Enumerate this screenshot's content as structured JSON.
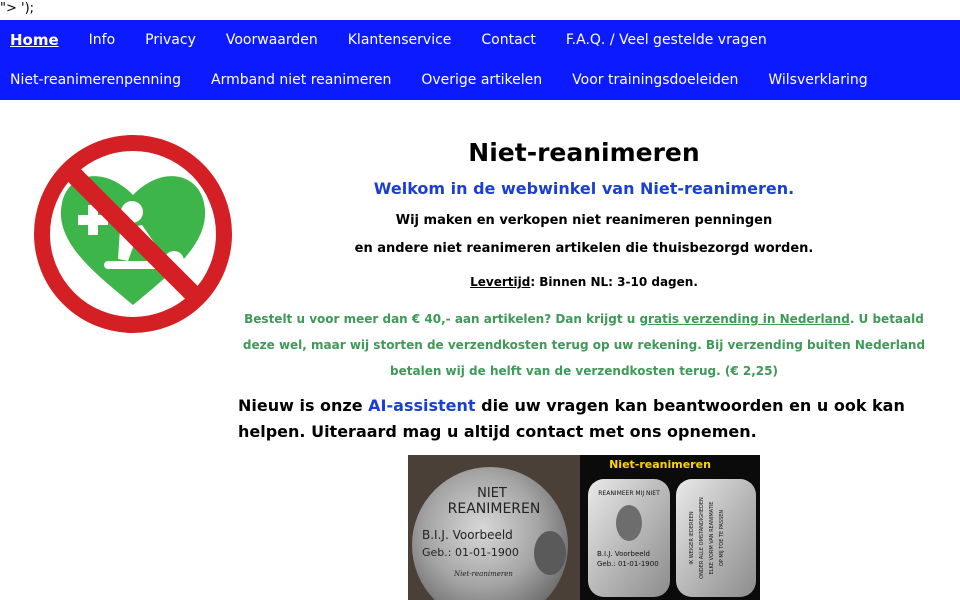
{
  "stray_text": "\"> ');",
  "nav": {
    "row1": [
      {
        "label": "Home",
        "active": true
      },
      {
        "label": "Info"
      },
      {
        "label": "Privacy"
      },
      {
        "label": "Voorwaarden"
      },
      {
        "label": "Klantenservice"
      },
      {
        "label": "Contact"
      },
      {
        "label": "F.A.Q. / Veel gestelde vragen"
      }
    ],
    "row2": [
      {
        "label": "Niet-reanimerenpenning"
      },
      {
        "label": "Armband niet reanimeren"
      },
      {
        "label": "Overige artikelen"
      },
      {
        "label": "Voor trainingsdoeleiden"
      },
      {
        "label": "Wilsverklaring"
      }
    ]
  },
  "main": {
    "title": "Niet-reanimeren",
    "welcome": "Welkom in de webwinkel van Niet-reanimeren.",
    "line1": "Wij maken en verkopen niet reanimeren penningen",
    "line2": "en andere niet reanimeren artikelen die thuisbezorgd worden.",
    "delivery": {
      "label": "Levertijd",
      "text": ": Binnen NL: 3-10 dagen."
    },
    "shipping": {
      "part1": "Bestelt u voor meer dan € 40,- aan artikelen? Dan krijgt u ",
      "link": "gratis verzending in Nederland",
      "part2": ". U betaald",
      "line2": "deze wel, maar wij storten de verzendkosten terug op uw rekening. Bij verzending buiten Nederland",
      "line3": "betalen wij de helft van de verzendkosten terug. (€ 2,25)"
    },
    "ai": {
      "before": "Nieuw is onze ",
      "link": "AI-assistent",
      "after": " die uw vragen kan beantwoorden en u ook kan",
      "line2": "helpen. Uiteraard mag u altijd contact met ons opnemen."
    }
  },
  "product_image": {
    "banner": "Niet-reanimeren",
    "coin_line1": "NIET",
    "coin_line2": "REANIMEREN",
    "coin_name": "B.I.J. Voorbeeld",
    "coin_date": "Geb.: 01-01-1900",
    "coin_signature": "Niet-reanimeren",
    "tag_header": "REANIMEER MIJ NIET",
    "tag_name": "B.I.J. Voorbeeld",
    "tag_date": "Geb.: 01-01-1900",
    "tag2_line1": "IK WEIGER IEDEREEN",
    "tag2_line2": "ONDER ALLE OMSTANDIGHEDEN",
    "tag2_line3": "ELKE VORM VAN REANIMATIE",
    "tag2_line4": "OP MIJ TOE TE PASSEN"
  },
  "colors": {
    "nav_bg": "#0c1aff",
    "welcome": "#1a3fd1",
    "shipping": "#3e9a57",
    "logo_red": "#d41f25",
    "logo_green": "#3eb54a"
  }
}
